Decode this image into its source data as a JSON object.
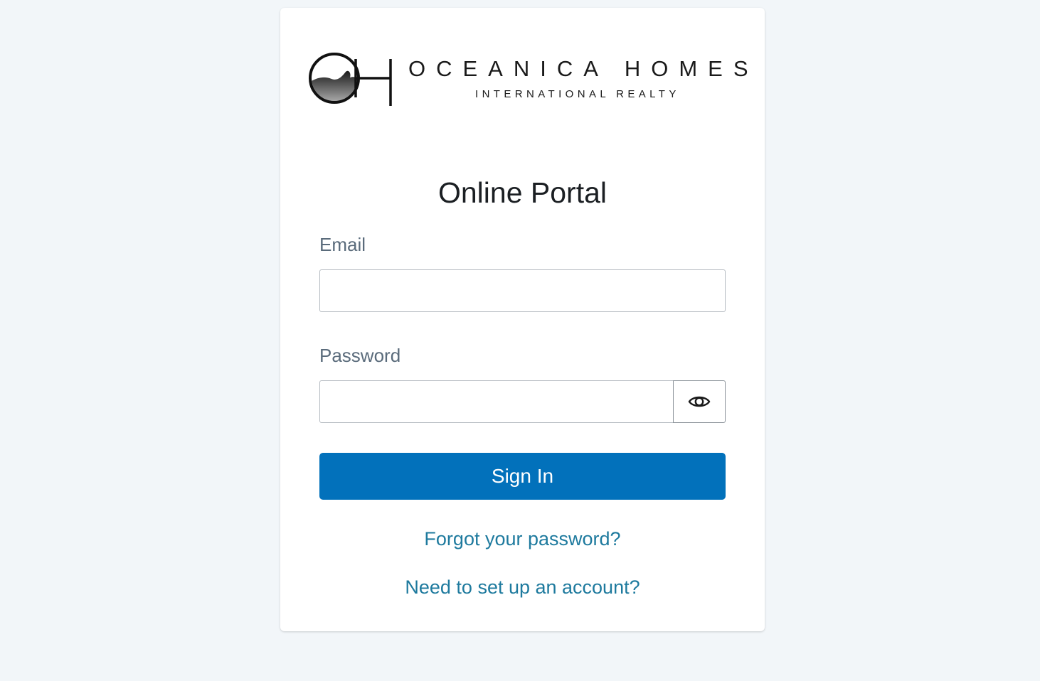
{
  "logo": {
    "name": "OCEANICA HOMES",
    "tagline": "INTERNATIONAL REALTY"
  },
  "title": "Online Portal",
  "form": {
    "email_label": "Email",
    "email_value": "",
    "password_label": "Password",
    "password_value": "",
    "toggle_icon": "eye-icon",
    "signin_label": "Sign In"
  },
  "links": {
    "forgot": "Forgot your password?",
    "setup": "Need to set up an account?"
  },
  "colors": {
    "background": "#f2f6f9",
    "primary": "#0271bb",
    "link": "#1e7a9e",
    "label": "#5a6b7b"
  }
}
